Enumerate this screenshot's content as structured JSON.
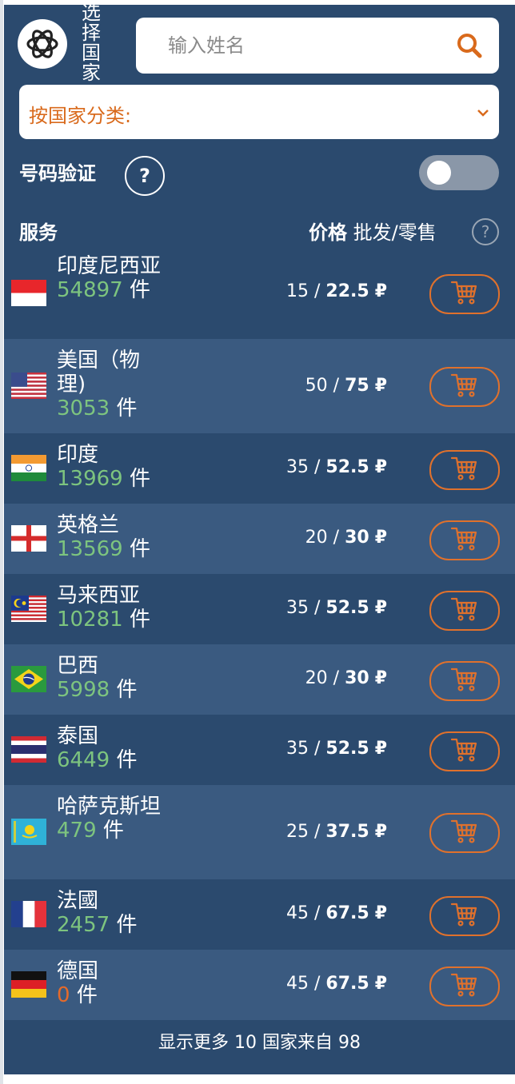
{
  "header": {
    "title": "选择国家",
    "search_placeholder": "输入姓名",
    "category_label": "按国家分类:"
  },
  "verification": {
    "label": "号码验证",
    "help": "?",
    "enabled": false
  },
  "table": {
    "col_service": "服务",
    "col_price_prefix": "价格",
    "col_price_suffix": " 批发/零售",
    "help": "?",
    "unit": "件",
    "currency": "₽",
    "rows": [
      {
        "name": "印度尼西亚",
        "count": "54897",
        "wholesale": "15",
        "retail": "22.5",
        "flag": "flag-indonesia"
      },
      {
        "name": "美国（物理)",
        "count": "3053",
        "wholesale": "50",
        "retail": "75",
        "flag": "flag-usa"
      },
      {
        "name": "印度",
        "count": "13969",
        "wholesale": "35",
        "retail": "52.5",
        "flag": "flag-india"
      },
      {
        "name": "英格兰",
        "count": "13569",
        "wholesale": "20",
        "retail": "30",
        "flag": "flag-england"
      },
      {
        "name": "马来西亚",
        "count": "10281",
        "wholesale": "35",
        "retail": "52.5",
        "flag": "flag-malaysia"
      },
      {
        "name": "巴西",
        "count": "5998",
        "wholesale": "20",
        "retail": "30",
        "flag": "flag-brazil"
      },
      {
        "name": "泰国",
        "count": "6449",
        "wholesale": "35",
        "retail": "52.5",
        "flag": "flag-thailand"
      },
      {
        "name": "哈萨克斯坦",
        "count": "479",
        "wholesale": "25",
        "retail": "37.5",
        "flag": "flag-kazakhstan"
      },
      {
        "name": "法國",
        "count": "2457",
        "wholesale": "45",
        "retail": "67.5",
        "flag": "flag-france"
      },
      {
        "name": "德国",
        "count": "0",
        "wholesale": "45",
        "retail": "67.5",
        "flag": "flag-germany"
      }
    ]
  },
  "footer": {
    "show_more": "显示更多 10 国家来自 98"
  },
  "colors": {
    "panel": "#2b4a6e",
    "row_alt": "#3a5a80",
    "accent": "#e0712c",
    "count_green": "#7dc47f"
  },
  "icons": {
    "logo": "openai-logo-icon",
    "search": "search-icon",
    "chevron": "chevron-down-icon",
    "cart": "cart-icon"
  }
}
